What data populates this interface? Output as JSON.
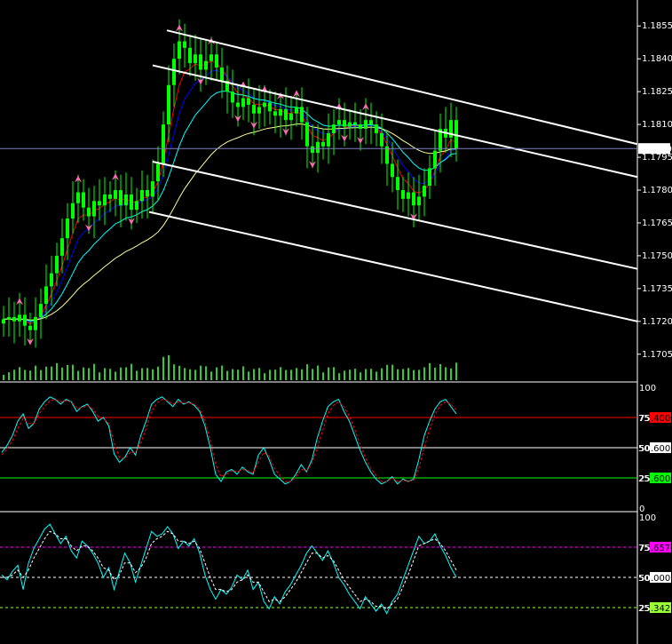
{
  "chart_data": [
    {
      "type": "candlestick",
      "title": "",
      "ylim": [
        1.1698,
        1.1862
      ],
      "price_ticks": [
        "1.1855",
        "1.1840",
        "1.1825",
        "1.1810",
        "1.1795",
        "1.1780",
        "1.1765",
        "1.1750",
        "1.1735",
        "1.1720",
        "1.1705"
      ],
      "current_price_label": "1.1799",
      "current_price": 1.1799,
      "colors": {
        "bar": "#00ff00",
        "ma_fast": "#ff0000",
        "ma_mid": "#0000ff",
        "ma_slow": "#00ffff",
        "ma_long": "#ffff99",
        "channel": "#ffffff",
        "fractal": "#ff69b4",
        "volume": "#33cc33",
        "price_line": "#8080c0"
      },
      "close_approx": [
        1.1721,
        1.1722,
        1.172,
        1.1723,
        1.1718,
        1.1716,
        1.1722,
        1.1728,
        1.1736,
        1.1742,
        1.175,
        1.1758,
        1.1767,
        1.1774,
        1.1779,
        1.1772,
        1.1768,
        1.1775,
        1.1773,
        1.1778,
        1.1776,
        1.178,
        1.1773,
        1.1778,
        1.1771,
        1.1775,
        1.178,
        1.1777,
        1.1784,
        1.1792,
        1.181,
        1.1828,
        1.184,
        1.1848,
        1.1845,
        1.1838,
        1.1842,
        1.1835,
        1.1839,
        1.1842,
        1.1836,
        1.183,
        1.1825,
        1.182,
        1.1818,
        1.1822,
        1.1819,
        1.1815,
        1.1818,
        1.182,
        1.1816,
        1.1814,
        1.1817,
        1.1812,
        1.1815,
        1.1818,
        1.1811,
        1.18,
        1.1797,
        1.1802,
        1.18,
        1.1806,
        1.181,
        1.1812,
        1.1809,
        1.1811,
        1.181,
        1.1808,
        1.1812,
        1.181,
        1.1806,
        1.18,
        1.1792,
        1.1786,
        1.178,
        1.1776,
        1.1779,
        1.1773,
        1.1777,
        1.1782,
        1.179,
        1.1798,
        1.1808,
        1.1804,
        1.1812,
        1.1799
      ],
      "channel_lines": [
        {
          "name": "upper",
          "from": [
            1.1853
          ],
          "to": [
            1.1801
          ]
        },
        {
          "name": "upper-mid",
          "from": [
            1.1837
          ],
          "to": [
            1.1786
          ]
        },
        {
          "name": "lower-mid",
          "from": [
            1.1793
          ],
          "to": [
            1.1744
          ]
        },
        {
          "name": "lower",
          "from": [
            1.177
          ],
          "to": [
            1.172
          ]
        }
      ]
    },
    {
      "type": "line",
      "title": "",
      "ylim": [
        0,
        100
      ],
      "ticks": [
        "100",
        "75",
        "50",
        "25",
        "0"
      ],
      "levels": [
        {
          "value": 75,
          "tick": "75",
          "label": ".4000",
          "color": "#ff0000",
          "style": "solid"
        },
        {
          "value": 50,
          "tick": "50",
          "label": ".6000",
          "color": "#ffffff",
          "style": "solid"
        },
        {
          "value": 25,
          "tick": "25",
          "label": ".6000",
          "color": "#00ff00",
          "style": "solid"
        }
      ],
      "series": [
        {
          "color": "#00ffff",
          "style": "solid",
          "values": [
            46,
            52,
            60,
            72,
            78,
            66,
            70,
            82,
            88,
            92,
            90,
            86,
            90,
            88,
            80,
            84,
            86,
            80,
            72,
            75,
            68,
            45,
            38,
            42,
            50,
            44,
            60,
            72,
            86,
            90,
            92,
            88,
            84,
            90,
            86,
            88,
            85,
            80,
            68,
            50,
            28,
            22,
            30,
            32,
            28,
            34,
            30,
            28,
            44,
            50,
            40,
            28,
            24,
            20,
            22,
            28,
            36,
            30,
            40,
            58,
            72,
            84,
            88,
            90,
            80,
            72,
            60,
            48,
            38,
            30,
            24,
            20,
            22,
            26,
            20,
            24,
            22,
            24,
            40,
            60,
            72,
            82,
            88,
            90,
            84,
            78
          ]
        },
        {
          "color": "#ff0000",
          "style": "dashed",
          "values": [
            44,
            49,
            56,
            66,
            74,
            70,
            70,
            78,
            84,
            89,
            90,
            88,
            89,
            88,
            83,
            83,
            85,
            82,
            76,
            74,
            70,
            54,
            42,
            41,
            46,
            46,
            54,
            66,
            80,
            87,
            90,
            89,
            86,
            88,
            87,
            87,
            86,
            82,
            72,
            56,
            36,
            26,
            28,
            31,
            30,
            32,
            31,
            29,
            38,
            46,
            43,
            33,
            27,
            22,
            22,
            26,
            32,
            31,
            37,
            50,
            64,
            78,
            85,
            88,
            84,
            76,
            65,
            53,
            42,
            33,
            27,
            22,
            22,
            25,
            22,
            23,
            22,
            23,
            33,
            50,
            65,
            77,
            85,
            88,
            86,
            81
          ]
        }
      ]
    },
    {
      "type": "line",
      "title": "",
      "ylim": [
        0,
        100
      ],
      "ticks": [
        "100",
        "75",
        "50",
        "25"
      ],
      "levels": [
        {
          "value": 75,
          "tick": "75",
          "label": ".6575",
          "color": "#ff00ff",
          "style": "dashed"
        },
        {
          "value": 50,
          "tick": "50",
          "label": ".0000",
          "color": "#ffffff",
          "style": "dashed"
        },
        {
          "value": 25,
          "tick": "25",
          "label": ".3425",
          "color": "#99ff33",
          "style": "dashed"
        }
      ],
      "series": [
        {
          "color": "#00ffff",
          "style": "solid",
          "values": [
            52,
            48,
            55,
            60,
            40,
            62,
            74,
            82,
            90,
            94,
            86,
            78,
            84,
            72,
            66,
            80,
            76,
            70,
            62,
            50,
            58,
            40,
            55,
            70,
            62,
            46,
            60,
            74,
            88,
            84,
            86,
            92,
            86,
            74,
            80,
            76,
            82,
            70,
            52,
            40,
            32,
            40,
            36,
            42,
            52,
            48,
            56,
            40,
            46,
            30,
            24,
            34,
            28,
            38,
            44,
            52,
            60,
            70,
            76,
            70,
            64,
            72,
            62,
            50,
            44,
            36,
            30,
            24,
            34,
            28,
            22,
            28,
            20,
            30,
            36,
            48,
            60,
            72,
            84,
            78,
            80,
            86,
            76,
            68,
            58,
            50
          ]
        },
        {
          "color": "#ffffff",
          "style": "dashed",
          "values": [
            50,
            50,
            52,
            56,
            50,
            56,
            66,
            74,
            82,
            88,
            86,
            82,
            82,
            76,
            72,
            76,
            76,
            72,
            66,
            58,
            56,
            48,
            52,
            62,
            62,
            54,
            58,
            66,
            78,
            82,
            84,
            88,
            86,
            80,
            80,
            78,
            80,
            74,
            62,
            50,
            40,
            40,
            38,
            40,
            46,
            48,
            52,
            46,
            46,
            38,
            30,
            32,
            30,
            34,
            40,
            46,
            54,
            62,
            70,
            70,
            66,
            68,
            64,
            56,
            48,
            42,
            36,
            30,
            32,
            30,
            26,
            26,
            24,
            28,
            32,
            42,
            52,
            64,
            76,
            78,
            80,
            82,
            78,
            72,
            64,
            56
          ]
        }
      ]
    }
  ]
}
